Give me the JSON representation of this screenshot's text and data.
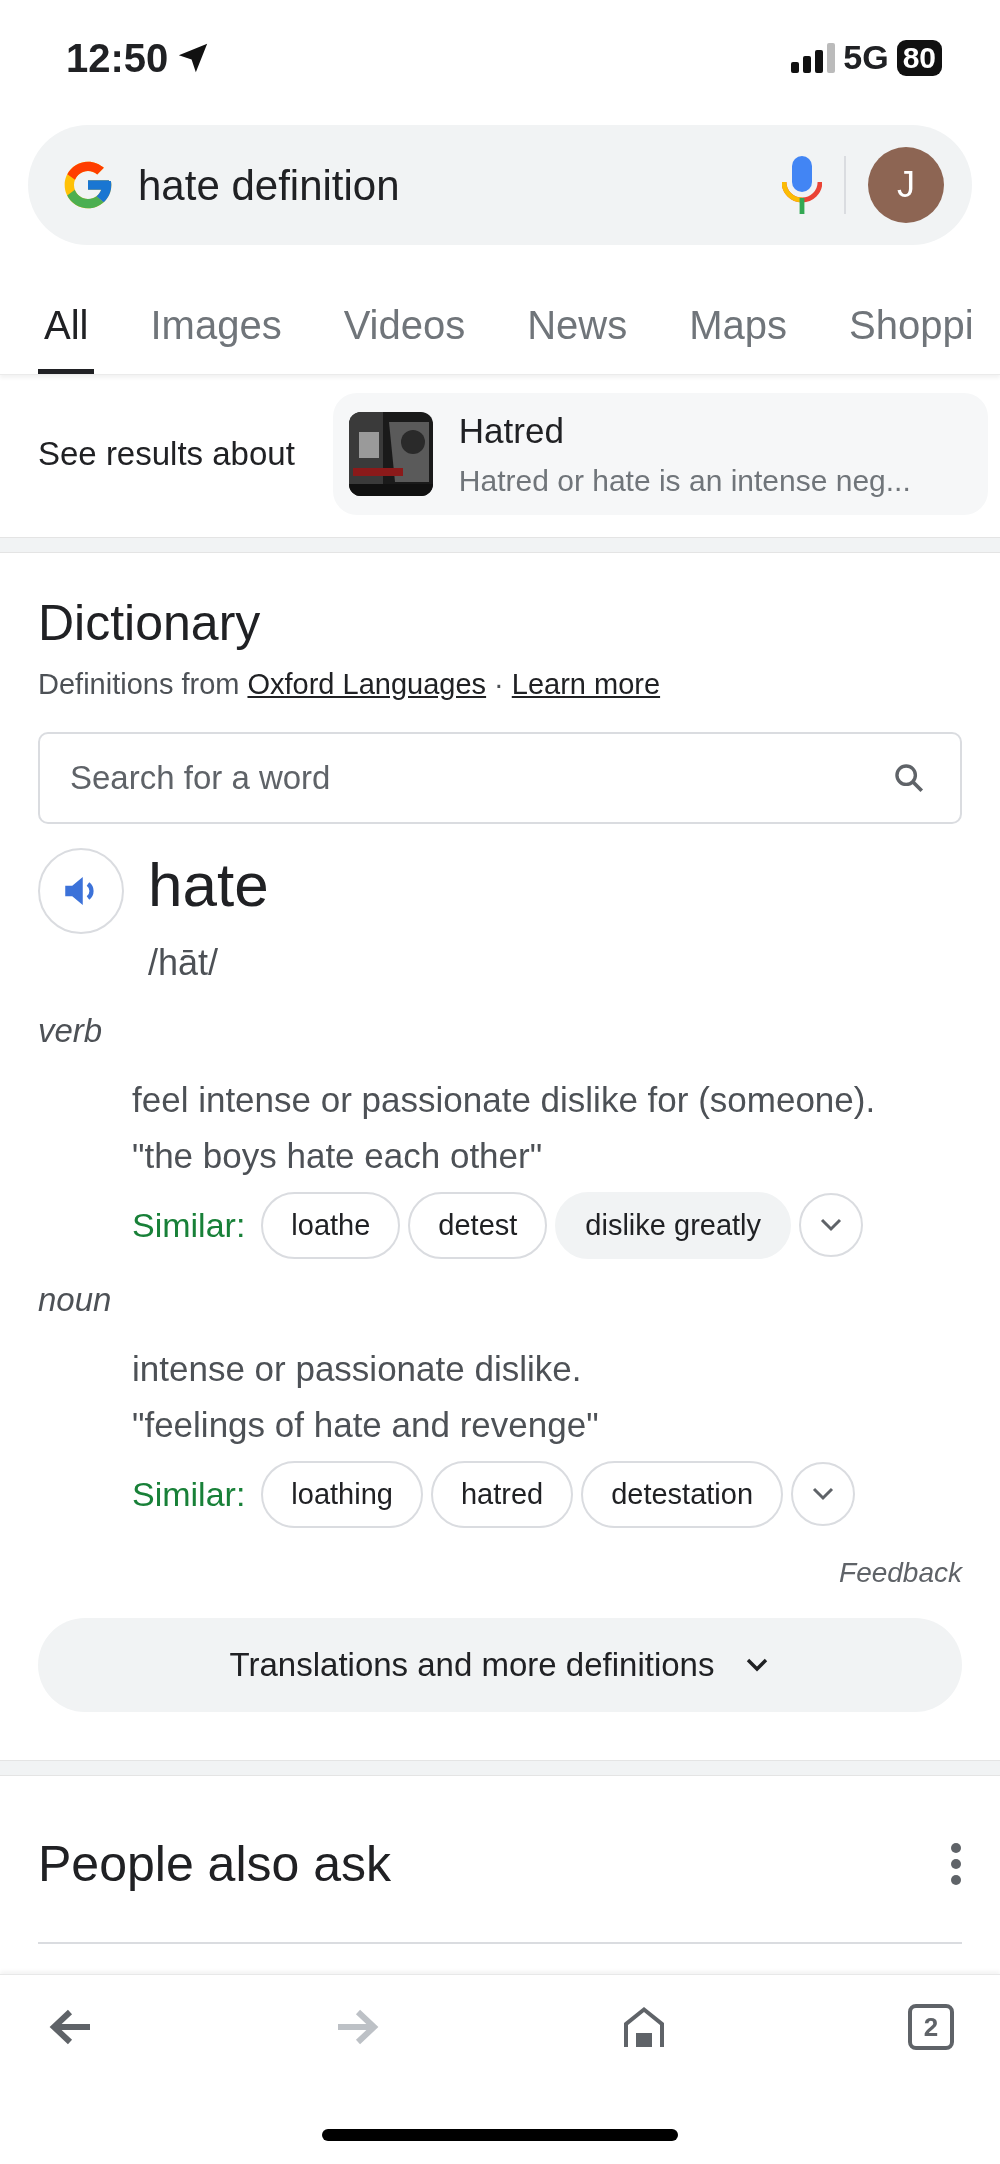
{
  "status_bar": {
    "time": "12:50",
    "network": "5G",
    "battery": "80"
  },
  "search": {
    "query": "hate definition",
    "avatar_letter": "J"
  },
  "tabs": [
    {
      "label": "All",
      "selected": true
    },
    {
      "label": "Images",
      "selected": false
    },
    {
      "label": "Videos",
      "selected": false
    },
    {
      "label": "News",
      "selected": false
    },
    {
      "label": "Maps",
      "selected": false
    },
    {
      "label": "Shoppi",
      "selected": false
    }
  ],
  "see_results": {
    "label": "See results about",
    "entity": {
      "title": "Hatred",
      "snippet": "Hatred or hate is an intense neg..."
    }
  },
  "dictionary": {
    "title": "Dictionary",
    "source_prefix": "Definitions from",
    "source_link": "Oxford Languages",
    "separator": "·",
    "learn_more": "Learn more",
    "search_placeholder": "Search for a word",
    "word": "hate",
    "phonetic": "/hāt/",
    "senses": [
      {
        "part_of_speech": "verb",
        "definition": "feel intense or passionate dislike for (someone).",
        "example": "\"the boys hate each other\"",
        "similar_label": "Similar:",
        "similar": [
          {
            "word": "loathe",
            "highlighted": false
          },
          {
            "word": "detest",
            "highlighted": false
          },
          {
            "word": "dislike greatly",
            "highlighted": true
          }
        ]
      },
      {
        "part_of_speech": "noun",
        "definition": "intense or passionate dislike.",
        "example": "\"feelings of hate and revenge\"",
        "similar_label": "Similar:",
        "similar": [
          {
            "word": "loathing",
            "highlighted": false
          },
          {
            "word": "hatred",
            "highlighted": false
          },
          {
            "word": "detestation",
            "highlighted": false
          }
        ]
      }
    ],
    "feedback": "Feedback",
    "more_button": "Translations and more definitions"
  },
  "people_also_ask": {
    "title": "People also ask"
  },
  "bottom_bar": {
    "forward_disabled": true,
    "tab_count": "2"
  }
}
